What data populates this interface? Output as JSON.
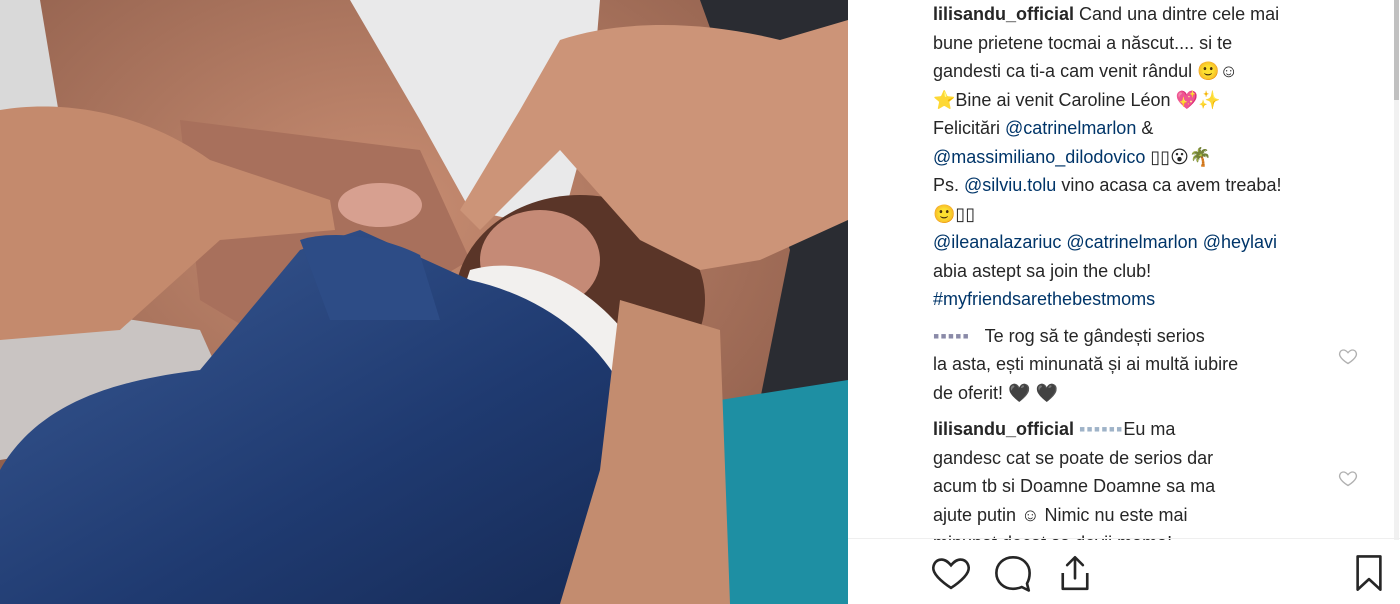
{
  "post": {
    "caption": {
      "username": "lilisandu_official",
      "line1_text": " Cand una dintre cele mai",
      "line2": "bune prietene tocmai a născut.... si te",
      "line3": "gandesti ca ti-a cam venit rândul 🙂☺",
      "line4": "⭐Bine ai venit Caroline Léon 💖✨",
      "line5_text": "Felicitări ",
      "line5_mention": "@catrinelmarlon",
      "line5_end": " &",
      "line6_mention": "@massimiliano_dilodovico",
      "line6_end": " ▯▯😮🌴",
      "line7_text": "Ps. ",
      "line7_mention": "@silviu.tolu",
      "line7_end": " vino acasa ca avem treaba!",
      "line8": "🙂▯▯",
      "line9_m1": "@ileanalazariuc",
      "line9_m2": "@catrinelmarlon",
      "line9_m3": "@heylavi",
      "line10": "abia astept sa join the club!",
      "line11_hashtag": "#myfriendsarethebestmoms"
    },
    "comments": [
      {
        "username_blurred": "▪▪▪▪▪",
        "lines": [
          "Te rog să te gândești serios",
          "la asta, ești minunată și ai multă iubire",
          "de oferit! 🖤 🖤"
        ]
      },
      {
        "username": "lilisandu_official",
        "mention_blurred": "▪▪▪▪▪▪",
        "lines": [
          "Eu ma",
          "gandesc cat se poate de serios dar",
          "acum tb si Doamne Doamne sa ma",
          "ajute putin ☺ Nimic nu este mai",
          "minunat decat sa devii mama!"
        ]
      }
    ]
  },
  "icons": {
    "like": "heart-outline-icon",
    "comment": "speech-bubble-icon",
    "share": "share-upload-icon",
    "save": "bookmark-icon",
    "comment_like": "small-heart-outline-icon"
  },
  "colors": {
    "mention": "#003569",
    "text": "#262626",
    "divider": "#efefef"
  }
}
